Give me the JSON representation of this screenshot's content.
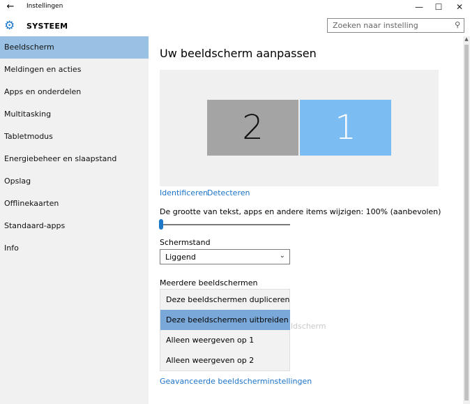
{
  "window": {
    "title": "Instellingen",
    "back_glyph": "←",
    "minimize_glyph": "—",
    "maximize_glyph": "☐",
    "close_glyph": "✕"
  },
  "header": {
    "section_title": "SYSTEEM",
    "gear_glyph": "⚙",
    "search_placeholder": "Zoeken naar instelling",
    "search_glyph": "⚲"
  },
  "sidebar": {
    "items": [
      {
        "label": "Beeldscherm",
        "active": true
      },
      {
        "label": "Meldingen en acties"
      },
      {
        "label": "Apps en onderdelen"
      },
      {
        "label": "Multitasking"
      },
      {
        "label": "Tabletmodus"
      },
      {
        "label": "Energiebeheer en slaapstand"
      },
      {
        "label": "Opslag"
      },
      {
        "label": "Offlinekaarten"
      },
      {
        "label": "Standaard-apps"
      },
      {
        "label": "Info"
      }
    ]
  },
  "main": {
    "title": "Uw beeldscherm aanpassen",
    "monitors": [
      {
        "number": "2"
      },
      {
        "number": "1"
      }
    ],
    "identify_link": "Identificeren",
    "detect_link": "Detecteren",
    "scale_label": "De grootte van tekst, apps en andere items wijzigen: 100% (aanbevolen)",
    "scale_value_percent": 0,
    "orientation_label": "Schermstand",
    "orientation_value": "Liggend",
    "multiple_label": "Meerdere beeldschermen",
    "multiple_options": [
      {
        "label": "Deze beeldschermen dupliceren"
      },
      {
        "label": "Deze beeldschermen uitbreiden",
        "selected": true
      },
      {
        "label": "Alleen weergeven op 1"
      },
      {
        "label": "Alleen weergeven op 2"
      }
    ],
    "obscured_text": "ldscherm",
    "advanced_link": "Geavanceerde beeldscherminstellingen"
  },
  "colors": {
    "accent": "#1e78c8",
    "sidebar_bg": "#f1f1f1",
    "sidebar_active": "#99c1e4",
    "monitor_1": "#7bbcf3",
    "monitor_2": "#a4a4a4",
    "dropdown_selected": "#7aa9d9"
  }
}
